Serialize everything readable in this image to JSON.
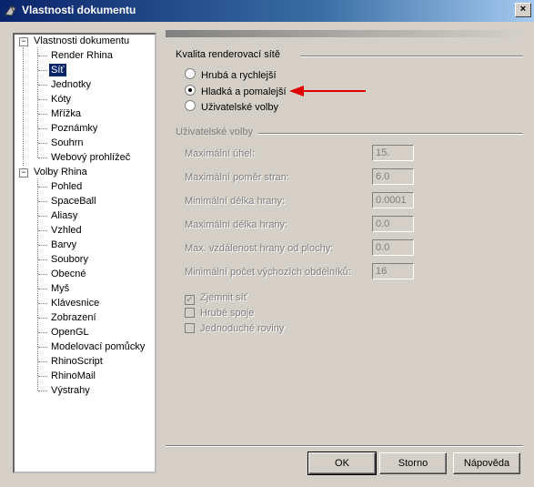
{
  "window": {
    "title": "Vlastnosti dokumentu"
  },
  "tree": {
    "root1": {
      "label": "Vlastnosti dokumentu",
      "expander": "−"
    },
    "root1_children": [
      "Render Rhina",
      "Síť",
      "Jednotky",
      "Kóty",
      "Mřížka",
      "Poznámky",
      "Souhrn",
      "Webový prohlížeč"
    ],
    "selected": "Síť",
    "root2": {
      "label": "Volby Rhina",
      "expander": "−"
    },
    "root2_children": [
      "Pohled",
      "SpaceBall",
      "Aliasy",
      "Vzhled",
      "Barvy",
      "Soubory",
      "Obecné",
      "Myš",
      "Klávesnice",
      "Zobrazení",
      "OpenGL",
      "Modelovací pomůcky",
      "RhinoScript",
      "RhinoMail",
      "Výstrahy"
    ]
  },
  "quality": {
    "group_label": "Kvalita renderovací sítě",
    "options": [
      {
        "label": "Hrubá a rychlejší",
        "checked": false
      },
      {
        "label": "Hladká a pomalejší",
        "checked": true
      },
      {
        "label": "Uživatelské volby",
        "checked": false
      }
    ]
  },
  "custom": {
    "group_label": "Uživatelské volby",
    "fields": [
      {
        "label": "Maximální úhel:",
        "value": "15."
      },
      {
        "label": "Maximální poměr stran:",
        "value": "6.0"
      },
      {
        "label": "Minimální délka hrany:",
        "value": "0.0001"
      },
      {
        "label": "Maximální délka hrany:",
        "value": "0.0"
      },
      {
        "label": "Max. vzdálenost hrany od plochy:",
        "value": "0.0"
      },
      {
        "label": "Minimální počet výchozích obdélníků:",
        "value": "16"
      }
    ],
    "checks": [
      {
        "label": "Zjemnit síť",
        "checked": true,
        "mark": "✓"
      },
      {
        "label": "Hrubé spoje",
        "checked": false,
        "mark": ""
      },
      {
        "label": "Jednoduché roviny",
        "checked": false,
        "mark": ""
      }
    ]
  },
  "buttons": {
    "ok": "OK",
    "cancel": "Storno",
    "help": "Nápověda"
  },
  "colors": {
    "annotation_arrow": "#e00000",
    "selection": "#0a246a"
  }
}
